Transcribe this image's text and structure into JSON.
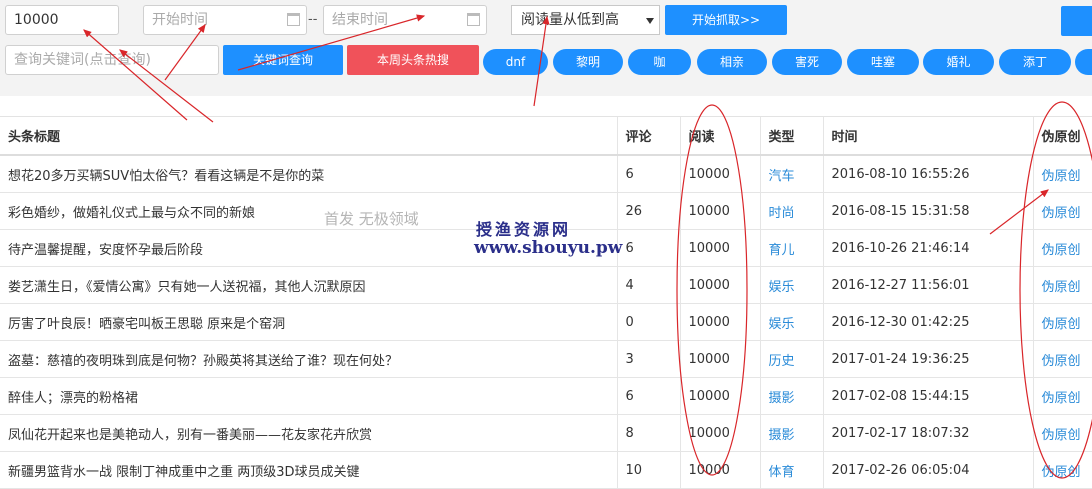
{
  "filters": {
    "read_count_value": "10000",
    "start_time_placeholder": "开始时间",
    "time_separator": "--",
    "end_time_placeholder": "结束时间",
    "sort_selected": "阅读量从低到高",
    "fetch_button": "开始抓取>>",
    "keyword_placeholder": "查询关键词(点击查询)",
    "keyword_button": "关键词查询",
    "hot_search_button": "本周头条热搜"
  },
  "hot_tags": [
    "dnf",
    "黎明",
    "咖",
    "相亲",
    "害死",
    "哇塞",
    "婚礼",
    "添丁"
  ],
  "table": {
    "headers": [
      "头条标题",
      "评论",
      "阅读",
      "类型",
      "时间",
      "伪原创"
    ],
    "rows": [
      {
        "title": "想花20多万买辆SUV怕太俗气？看看这辆是不是你的菜",
        "comments": "6",
        "reads": "10000",
        "type": "汽车",
        "time": "2016-08-10 16:55:26",
        "action": "伪原创"
      },
      {
        "title": "彩色婚纱，做婚礼仪式上最与众不同的新娘",
        "comments": "26",
        "reads": "10000",
        "type": "时尚",
        "time": "2016-08-15 15:31:58",
        "action": "伪原创"
      },
      {
        "title": "待产温馨提醒，安度怀孕最后阶段",
        "comments": "6",
        "reads": "10000",
        "type": "育儿",
        "time": "2016-10-26 21:46:14",
        "action": "伪原创"
      },
      {
        "title": "娄艺潇生日，《爱情公寓》只有她一人送祝福，其他人沉默原因",
        "comments": "4",
        "reads": "10000",
        "type": "娱乐",
        "time": "2016-12-27 11:56:01",
        "action": "伪原创"
      },
      {
        "title": "厉害了叶良辰！晒豪宅叫板王思聪 原来是个窑洞",
        "comments": "0",
        "reads": "10000",
        "type": "娱乐",
        "time": "2016-12-30 01:42:25",
        "action": "伪原创"
      },
      {
        "title": "盗墓：慈禧的夜明珠到底是何物？孙殿英将其送给了谁？现在何处？",
        "comments": "3",
        "reads": "10000",
        "type": "历史",
        "time": "2017-01-24 19:36:25",
        "action": "伪原创"
      },
      {
        "title": "醉佳人；漂亮的粉格裙",
        "comments": "6",
        "reads": "10000",
        "type": "摄影",
        "time": "2017-02-08 15:44:15",
        "action": "伪原创"
      },
      {
        "title": "凤仙花开起来也是美艳动人，别有一番美丽——花友家花卉欣赏",
        "comments": "8",
        "reads": "10000",
        "type": "摄影",
        "time": "2017-02-17 18:07:32",
        "action": "伪原创"
      },
      {
        "title": "新疆男篮背水一战 限制丁神成重中之重 两顶级3D球员成关键",
        "comments": "10",
        "reads": "10000",
        "type": "体育",
        "time": "2017-02-26 06:05:04",
        "action": "伪原创"
      }
    ]
  },
  "watermark": {
    "line1": "首发 无极领域",
    "line2": "授渔资源网",
    "line3": "www.shouyu.pw"
  },
  "colors": {
    "accent_blue": "#1e90ff",
    "accent_red": "#f0525a",
    "link_blue": "#2a8bd8",
    "annotation_red": "#d9262a"
  }
}
